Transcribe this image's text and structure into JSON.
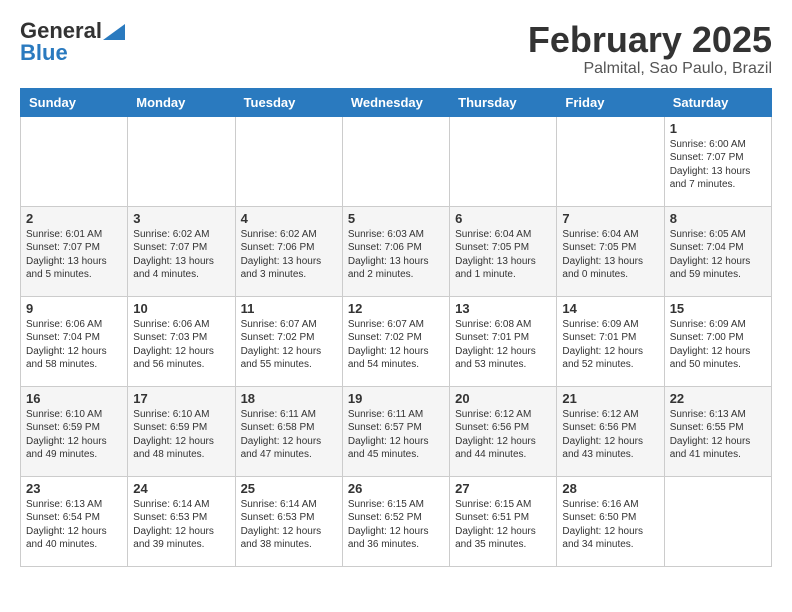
{
  "header": {
    "logo_general": "General",
    "logo_blue": "Blue",
    "month_title": "February 2025",
    "location": "Palmital, Sao Paulo, Brazil"
  },
  "calendar": {
    "days_of_week": [
      "Sunday",
      "Monday",
      "Tuesday",
      "Wednesday",
      "Thursday",
      "Friday",
      "Saturday"
    ],
    "weeks": [
      {
        "cells": [
          {
            "day": "",
            "info": ""
          },
          {
            "day": "",
            "info": ""
          },
          {
            "day": "",
            "info": ""
          },
          {
            "day": "",
            "info": ""
          },
          {
            "day": "",
            "info": ""
          },
          {
            "day": "",
            "info": ""
          },
          {
            "day": "1",
            "info": "Sunrise: 6:00 AM\nSunset: 7:07 PM\nDaylight: 13 hours and 7 minutes."
          }
        ]
      },
      {
        "cells": [
          {
            "day": "2",
            "info": "Sunrise: 6:01 AM\nSunset: 7:07 PM\nDaylight: 13 hours and 5 minutes."
          },
          {
            "day": "3",
            "info": "Sunrise: 6:02 AM\nSunset: 7:07 PM\nDaylight: 13 hours and 4 minutes."
          },
          {
            "day": "4",
            "info": "Sunrise: 6:02 AM\nSunset: 7:06 PM\nDaylight: 13 hours and 3 minutes."
          },
          {
            "day": "5",
            "info": "Sunrise: 6:03 AM\nSunset: 7:06 PM\nDaylight: 13 hours and 2 minutes."
          },
          {
            "day": "6",
            "info": "Sunrise: 6:04 AM\nSunset: 7:05 PM\nDaylight: 13 hours and 1 minute."
          },
          {
            "day": "7",
            "info": "Sunrise: 6:04 AM\nSunset: 7:05 PM\nDaylight: 13 hours and 0 minutes."
          },
          {
            "day": "8",
            "info": "Sunrise: 6:05 AM\nSunset: 7:04 PM\nDaylight: 12 hours and 59 minutes."
          }
        ]
      },
      {
        "cells": [
          {
            "day": "9",
            "info": "Sunrise: 6:06 AM\nSunset: 7:04 PM\nDaylight: 12 hours and 58 minutes."
          },
          {
            "day": "10",
            "info": "Sunrise: 6:06 AM\nSunset: 7:03 PM\nDaylight: 12 hours and 56 minutes."
          },
          {
            "day": "11",
            "info": "Sunrise: 6:07 AM\nSunset: 7:02 PM\nDaylight: 12 hours and 55 minutes."
          },
          {
            "day": "12",
            "info": "Sunrise: 6:07 AM\nSunset: 7:02 PM\nDaylight: 12 hours and 54 minutes."
          },
          {
            "day": "13",
            "info": "Sunrise: 6:08 AM\nSunset: 7:01 PM\nDaylight: 12 hours and 53 minutes."
          },
          {
            "day": "14",
            "info": "Sunrise: 6:09 AM\nSunset: 7:01 PM\nDaylight: 12 hours and 52 minutes."
          },
          {
            "day": "15",
            "info": "Sunrise: 6:09 AM\nSunset: 7:00 PM\nDaylight: 12 hours and 50 minutes."
          }
        ]
      },
      {
        "cells": [
          {
            "day": "16",
            "info": "Sunrise: 6:10 AM\nSunset: 6:59 PM\nDaylight: 12 hours and 49 minutes."
          },
          {
            "day": "17",
            "info": "Sunrise: 6:10 AM\nSunset: 6:59 PM\nDaylight: 12 hours and 48 minutes."
          },
          {
            "day": "18",
            "info": "Sunrise: 6:11 AM\nSunset: 6:58 PM\nDaylight: 12 hours and 47 minutes."
          },
          {
            "day": "19",
            "info": "Sunrise: 6:11 AM\nSunset: 6:57 PM\nDaylight: 12 hours and 45 minutes."
          },
          {
            "day": "20",
            "info": "Sunrise: 6:12 AM\nSunset: 6:56 PM\nDaylight: 12 hours and 44 minutes."
          },
          {
            "day": "21",
            "info": "Sunrise: 6:12 AM\nSunset: 6:56 PM\nDaylight: 12 hours and 43 minutes."
          },
          {
            "day": "22",
            "info": "Sunrise: 6:13 AM\nSunset: 6:55 PM\nDaylight: 12 hours and 41 minutes."
          }
        ]
      },
      {
        "cells": [
          {
            "day": "23",
            "info": "Sunrise: 6:13 AM\nSunset: 6:54 PM\nDaylight: 12 hours and 40 minutes."
          },
          {
            "day": "24",
            "info": "Sunrise: 6:14 AM\nSunset: 6:53 PM\nDaylight: 12 hours and 39 minutes."
          },
          {
            "day": "25",
            "info": "Sunrise: 6:14 AM\nSunset: 6:53 PM\nDaylight: 12 hours and 38 minutes."
          },
          {
            "day": "26",
            "info": "Sunrise: 6:15 AM\nSunset: 6:52 PM\nDaylight: 12 hours and 36 minutes."
          },
          {
            "day": "27",
            "info": "Sunrise: 6:15 AM\nSunset: 6:51 PM\nDaylight: 12 hours and 35 minutes."
          },
          {
            "day": "28",
            "info": "Sunrise: 6:16 AM\nSunset: 6:50 PM\nDaylight: 12 hours and 34 minutes."
          },
          {
            "day": "",
            "info": ""
          }
        ]
      }
    ]
  }
}
